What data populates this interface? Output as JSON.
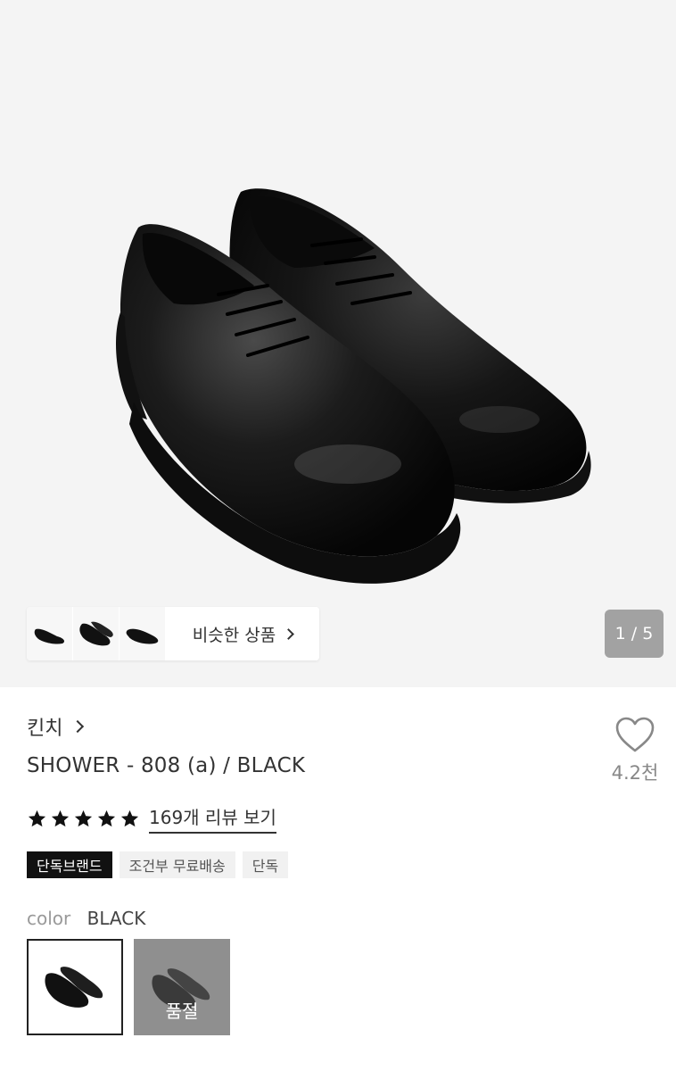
{
  "gallery": {
    "image": "black-derby-shoes-pair",
    "counter": "1 / 5",
    "thumbnails": [
      "shoe-side-view",
      "shoe-pair-front",
      "shoe-side-view-2"
    ],
    "similar_label": "비슷한 상품"
  },
  "product": {
    "brand": "킨치",
    "title": "SHOWER - 808 (a) / BLACK",
    "rating_stars": 5,
    "review_link": "169개 리뷰 보기",
    "like_count": "4.2천",
    "badges": [
      "단독브랜드",
      "조건부 무료배송",
      "단독"
    ]
  },
  "options": {
    "color_label": "color",
    "color_value": "BLACK",
    "swatches": [
      {
        "name": "black-shoe",
        "selected": true
      },
      {
        "name": "gray-shoe",
        "soldout_label": "품절"
      }
    ]
  },
  "colors": {
    "accent_dark": "#111111",
    "badge_bg": "#f1f1f1",
    "hero_bg": "#f4f4f4"
  }
}
